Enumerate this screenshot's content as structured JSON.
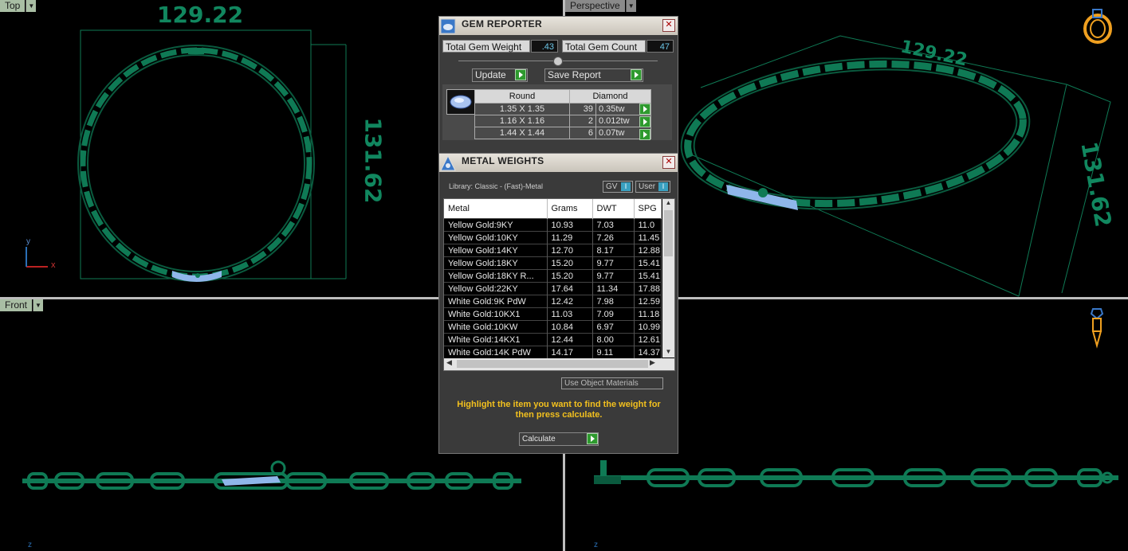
{
  "viewports": {
    "top": {
      "label": "Top",
      "dim_width": "129.22",
      "dim_height": "131.62",
      "axis_y": "y",
      "axis_x": "x"
    },
    "perspective": {
      "label": "Perspective",
      "dim_width": "129.22",
      "dim_height": "131.62"
    },
    "front": {
      "label": "Front",
      "axis_z": "z"
    },
    "right": {
      "axis_z": "z"
    }
  },
  "gem_reporter": {
    "title": "GEM REPORTER",
    "total_weight_label": "Total Gem Weight",
    "total_weight_value": ".43",
    "total_count_label": "Total Gem Count",
    "total_count_value": "47",
    "update_label": "Update",
    "save_report_label": "Save Report",
    "shape": "Round",
    "stone": "Diamond",
    "rows": [
      {
        "size": "1.35 X 1.35",
        "count": "39",
        "weight": "0.35tw"
      },
      {
        "size": "1.16 X 1.16",
        "count": "2",
        "weight": "0.012tw"
      },
      {
        "size": "1.44 X 1.44",
        "count": "6",
        "weight": "0.07tw"
      }
    ]
  },
  "metal_weights": {
    "title": "METAL WEIGHTS",
    "library": "Library: Classic - (Fast)-Metal",
    "gv_label": "GV",
    "user_label": "User",
    "columns": [
      "Metal",
      "Grams",
      "DWT",
      "SPG"
    ],
    "rows": [
      {
        "metal": "Yellow Gold:9KY",
        "grams": "10.93",
        "dwt": "7.03",
        "spg": "11.0"
      },
      {
        "metal": "Yellow Gold:10KY",
        "grams": "11.29",
        "dwt": "7.26",
        "spg": "11.45"
      },
      {
        "metal": "Yellow Gold:14KY",
        "grams": "12.70",
        "dwt": "8.17",
        "spg": "12.88"
      },
      {
        "metal": "Yellow Gold:18KY",
        "grams": "15.20",
        "dwt": "9.77",
        "spg": "15.41"
      },
      {
        "metal": "Yellow Gold:18KY R...",
        "grams": "15.20",
        "dwt": "9.77",
        "spg": "15.41"
      },
      {
        "metal": "Yellow Gold:22KY",
        "grams": "17.64",
        "dwt": "11.34",
        "spg": "17.88"
      },
      {
        "metal": "White Gold:9K PdW",
        "grams": "12.42",
        "dwt": "7.98",
        "spg": "12.59"
      },
      {
        "metal": "White Gold:10KX1",
        "grams": "11.03",
        "dwt": "7.09",
        "spg": "11.18"
      },
      {
        "metal": "White Gold:10KW",
        "grams": "10.84",
        "dwt": "6.97",
        "spg": "10.99"
      },
      {
        "metal": "White Gold:14KX1",
        "grams": "12.44",
        "dwt": "8.00",
        "spg": "12.61"
      },
      {
        "metal": "White Gold:14K PdW",
        "grams": "14.17",
        "dwt": "9.11",
        "spg": "14.37"
      }
    ],
    "use_object_materials": "Use Object Materials",
    "hint": "Highlight the item you want to find the weight for then press calculate.",
    "calculate_label": "Calculate"
  },
  "colors": {
    "model": "#0f7a55",
    "dimension": "#11875f",
    "gems": "#8fb6ea",
    "hint": "#f2c01e",
    "icon_orange": "#f0a020"
  }
}
